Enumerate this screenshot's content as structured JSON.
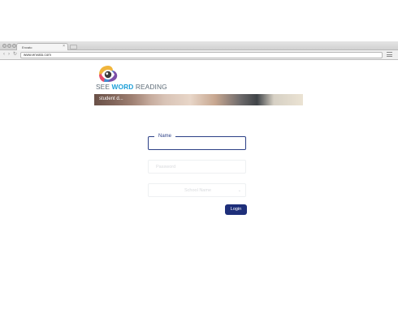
{
  "browser": {
    "tab_title": "Envato",
    "tab_close": "×",
    "url": "www.envato.com",
    "back": "‹",
    "forward": "›",
    "reload": "↻"
  },
  "logo": {
    "see": "SEE ",
    "word": "WORD",
    "reading": " READING"
  },
  "banner": {
    "text": "student d..."
  },
  "form": {
    "name_label": "Name",
    "name_value": "",
    "password_placeholder": "Password",
    "school_label": "School Name",
    "school_caret": "⌄",
    "login_label": "Login"
  },
  "colors": {
    "accent": "#1e2f7a",
    "logo_word": "#1d9fd8",
    "logo_text": "#5f6d78"
  }
}
